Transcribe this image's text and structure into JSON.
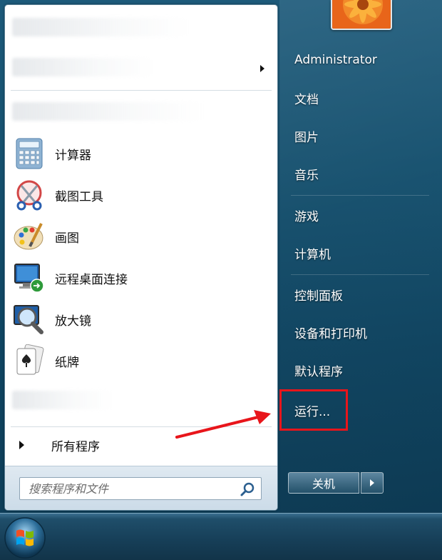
{
  "left_panel": {
    "apps": [
      {
        "label": "计算器",
        "icon": "calculator-icon"
      },
      {
        "label": "截图工具",
        "icon": "snipping-tool-icon"
      },
      {
        "label": "画图",
        "icon": "paint-icon"
      },
      {
        "label": "远程桌面连接",
        "icon": "remote-desktop-icon"
      },
      {
        "label": "放大镜",
        "icon": "magnifier-icon"
      },
      {
        "label": "纸牌",
        "icon": "solitaire-icon"
      }
    ],
    "all_programs_label": "所有程序",
    "search_placeholder": "搜索程序和文件"
  },
  "right_panel": {
    "user_name": "Administrator",
    "items": [
      {
        "label": "文档"
      },
      {
        "label": "图片"
      },
      {
        "label": "音乐"
      },
      {
        "label": "游戏"
      },
      {
        "label": "计算机"
      },
      {
        "label": "控制面板"
      },
      {
        "label": "设备和打印机"
      },
      {
        "label": "默认程序"
      },
      {
        "label": "运行..."
      }
    ],
    "shutdown_label": "关机"
  },
  "annotation": {
    "highlight_color": "#e8151b",
    "arrow_color": "#e8151b"
  }
}
